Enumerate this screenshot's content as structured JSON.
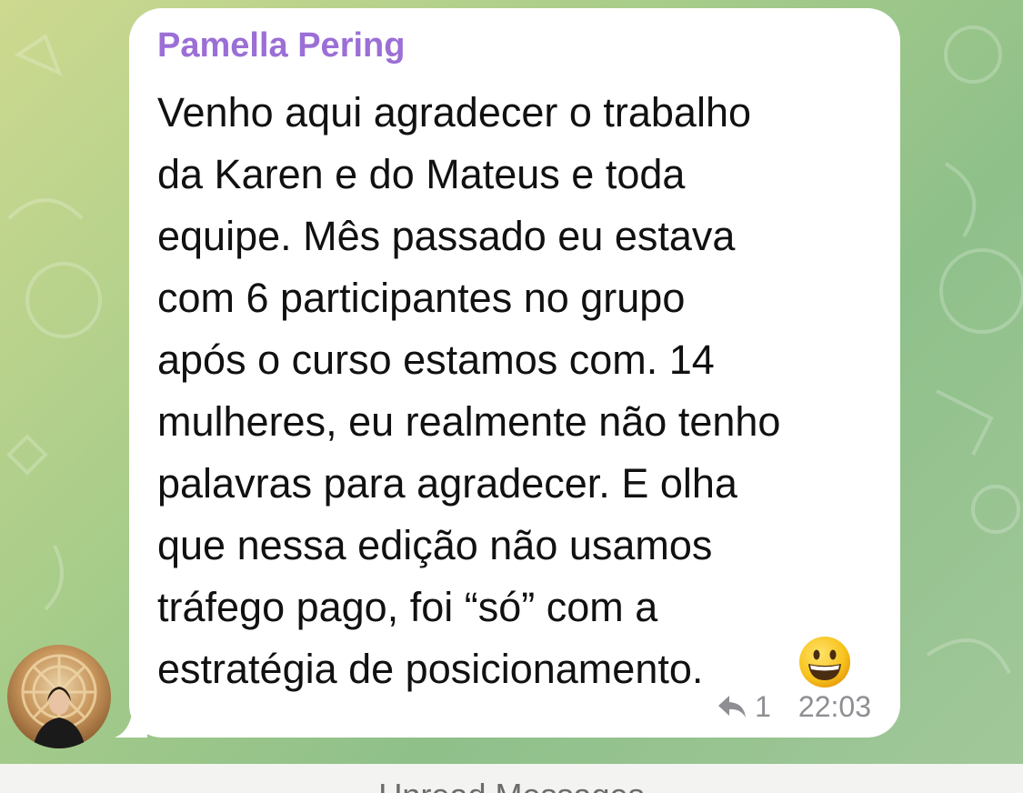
{
  "message": {
    "sender": "Pamella Pering",
    "lines": [
      "Venho aqui agradecer o trabalho",
      "da Karen e do Mateus e toda",
      "equipe. Mês passado eu estava",
      "com 6 participantes no grupo",
      "após o curso estamos com. 14",
      "mulheres, eu realmente não tenho",
      "palavras para agradecer. E olha",
      "que nessa edição não usamos",
      "tráfego pago, foi “só” com a",
      "estratégia de posicionamento."
    ],
    "emoji": "grinning-face",
    "reply_count": "1",
    "time": "22:03"
  },
  "unread_label": "Unread Messages",
  "colors": {
    "sender_name": "#9b6fd6",
    "bubble": "#ffffff",
    "meta_text": "#8e8e93"
  }
}
